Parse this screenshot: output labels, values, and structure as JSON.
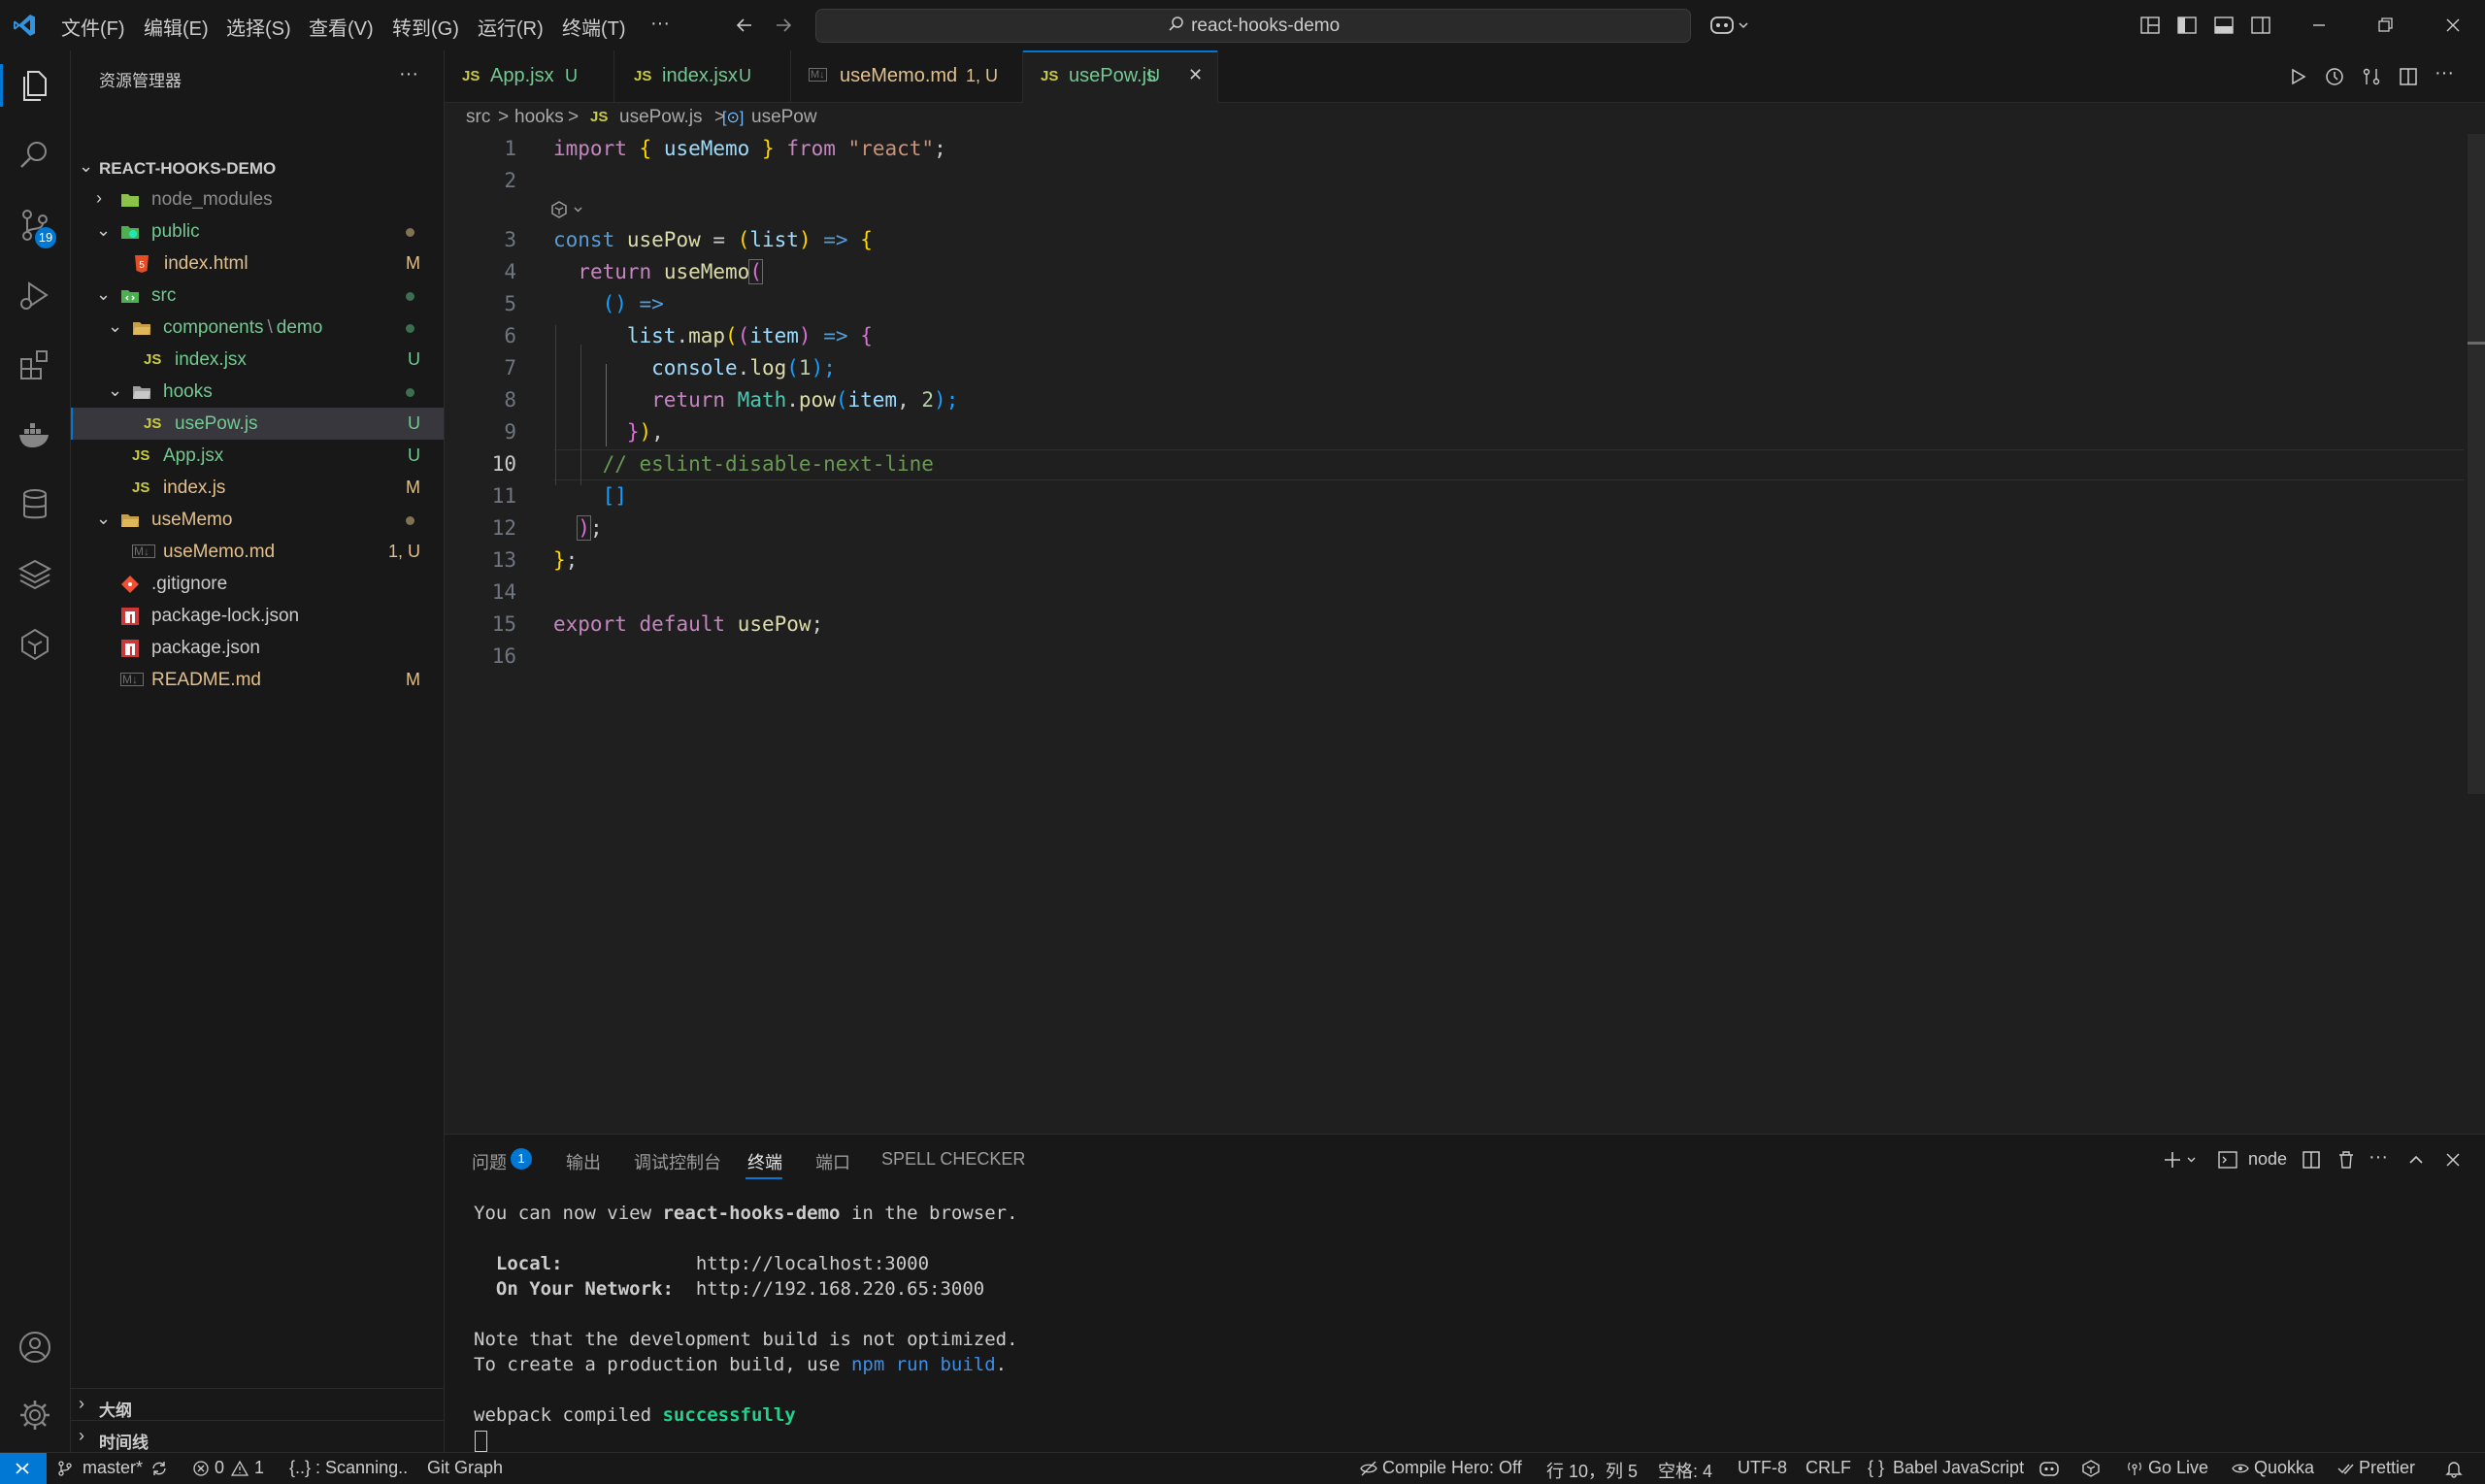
{
  "titlebar": {
    "menus": [
      "文件(F)",
      "编辑(E)",
      "选择(S)",
      "查看(V)",
      "转到(G)",
      "运行(R)",
      "终端(T)",
      "···"
    ],
    "search": "react-hooks-demo"
  },
  "activity": {
    "scm_badge": "19"
  },
  "sidebar": {
    "header": "资源管理器",
    "more": "···",
    "project": "REACT-HOOKS-DEMO",
    "items": [
      {
        "name": "node_modules",
        "badge": ""
      },
      {
        "name": "public",
        "badge": ""
      },
      {
        "name": "index.html",
        "badge": "M"
      },
      {
        "name": "src",
        "badge": ""
      },
      {
        "name": "components",
        "sep": "\\",
        "name2": "demo",
        "badge": ""
      },
      {
        "name": "index.jsx",
        "badge": "U"
      },
      {
        "name": "hooks",
        "badge": ""
      },
      {
        "name": "usePow.js",
        "badge": "U"
      },
      {
        "name": "App.jsx",
        "badge": "U"
      },
      {
        "name": "index.js",
        "badge": "M"
      },
      {
        "name": "useMemo",
        "badge": ""
      },
      {
        "name": "useMemo.md",
        "badge": "1, U"
      },
      {
        "name": ".gitignore",
        "badge": ""
      },
      {
        "name": "package-lock.json",
        "badge": ""
      },
      {
        "name": "package.json",
        "badge": ""
      },
      {
        "name": "README.md",
        "badge": "M"
      }
    ],
    "outline": "大纲",
    "timeline": "时间线"
  },
  "tabs": [
    {
      "icon": "JS",
      "label": "App.jsx",
      "status": "U"
    },
    {
      "icon": "JS",
      "label": "index.jsx",
      "status": "U"
    },
    {
      "icon": "M↓",
      "label": "useMemo.md",
      "status": "1, U"
    },
    {
      "icon": "JS",
      "label": "usePow.js",
      "status": "U",
      "close": "✕"
    }
  ],
  "breadcrumb": {
    "parts": [
      "src",
      "hooks"
    ],
    "file": "usePow.js",
    "symbol": "usePow",
    "sep": ">",
    "js": "JS",
    "sym_icon": "[⊙]"
  },
  "editor": {
    "line_numbers": [
      "1",
      "2",
      "",
      "3",
      "4",
      "5",
      "6",
      "7",
      "8",
      "9",
      "10",
      "11",
      "12",
      "13",
      "14",
      "15",
      "16"
    ],
    "code": {
      "l1": [
        "import",
        "{",
        "useMemo",
        "}",
        "from",
        "\"react\"",
        ";"
      ],
      "l3": [
        "const",
        "usePow",
        "=",
        "(",
        "list",
        ")",
        "=>",
        "{"
      ],
      "l4": [
        "return",
        "useMemo",
        "("
      ],
      "l5": [
        "()",
        "=>"
      ],
      "l6": [
        "list",
        ".",
        "map",
        "(",
        "(",
        "item",
        ")",
        "=>",
        "{"
      ],
      "l7": [
        "console",
        ".",
        "log",
        "(",
        "1",
        ");"
      ],
      "l8": [
        "return",
        "Math",
        ".",
        "pow",
        "(",
        "item",
        ",",
        "2",
        ");"
      ],
      "l9": [
        "}",
        ")",
        ","
      ],
      "l10": "// eslint-disable-next-line",
      "l11": "[]",
      "l12": [
        ")",
        ";"
      ],
      "l13": [
        "}",
        ";"
      ],
      "l15": [
        "export",
        "default",
        "usePow",
        ";"
      ]
    }
  },
  "panel": {
    "tabs": [
      "问题",
      "输出",
      "调试控制台",
      "终端",
      "端口",
      "SPELL CHECKER"
    ],
    "problems_count": "1",
    "node_label": "node",
    "terminal": {
      "l1_a": "You can now view ",
      "l1_b": "react-hooks-demo",
      "l1_c": " in the browser.",
      "local_label": "Local:",
      "local_url": "http://localhost:3000",
      "net_label": "On Your Network:",
      "net_url": "http://192.168.220.65:3000",
      "note": "Note that the development build is not optimized.",
      "create_a": "To create a production build, use ",
      "create_b": "npm run build",
      "create_c": ".",
      "wp_a": "webpack compiled ",
      "wp_b": "successfully"
    }
  },
  "status": {
    "branch": "master*",
    "errors": "0",
    "warnings": "1",
    "scanning": "{..} : Scanning..",
    "git_graph": "Git Graph",
    "compile_hero": "Compile Hero: Off",
    "position": "行 10，列 5",
    "spaces": "空格: 4",
    "encoding": "UTF-8",
    "eol": "CRLF",
    "language": "Babel JavaScript",
    "go_live": "Go Live",
    "quokka": "Quokka",
    "prettier": "Prettier"
  },
  "colors": {
    "accent": "#0078d4",
    "untracked": "#73c991",
    "modified": "#e2c08d",
    "js_yellow": "#cbcb41"
  }
}
